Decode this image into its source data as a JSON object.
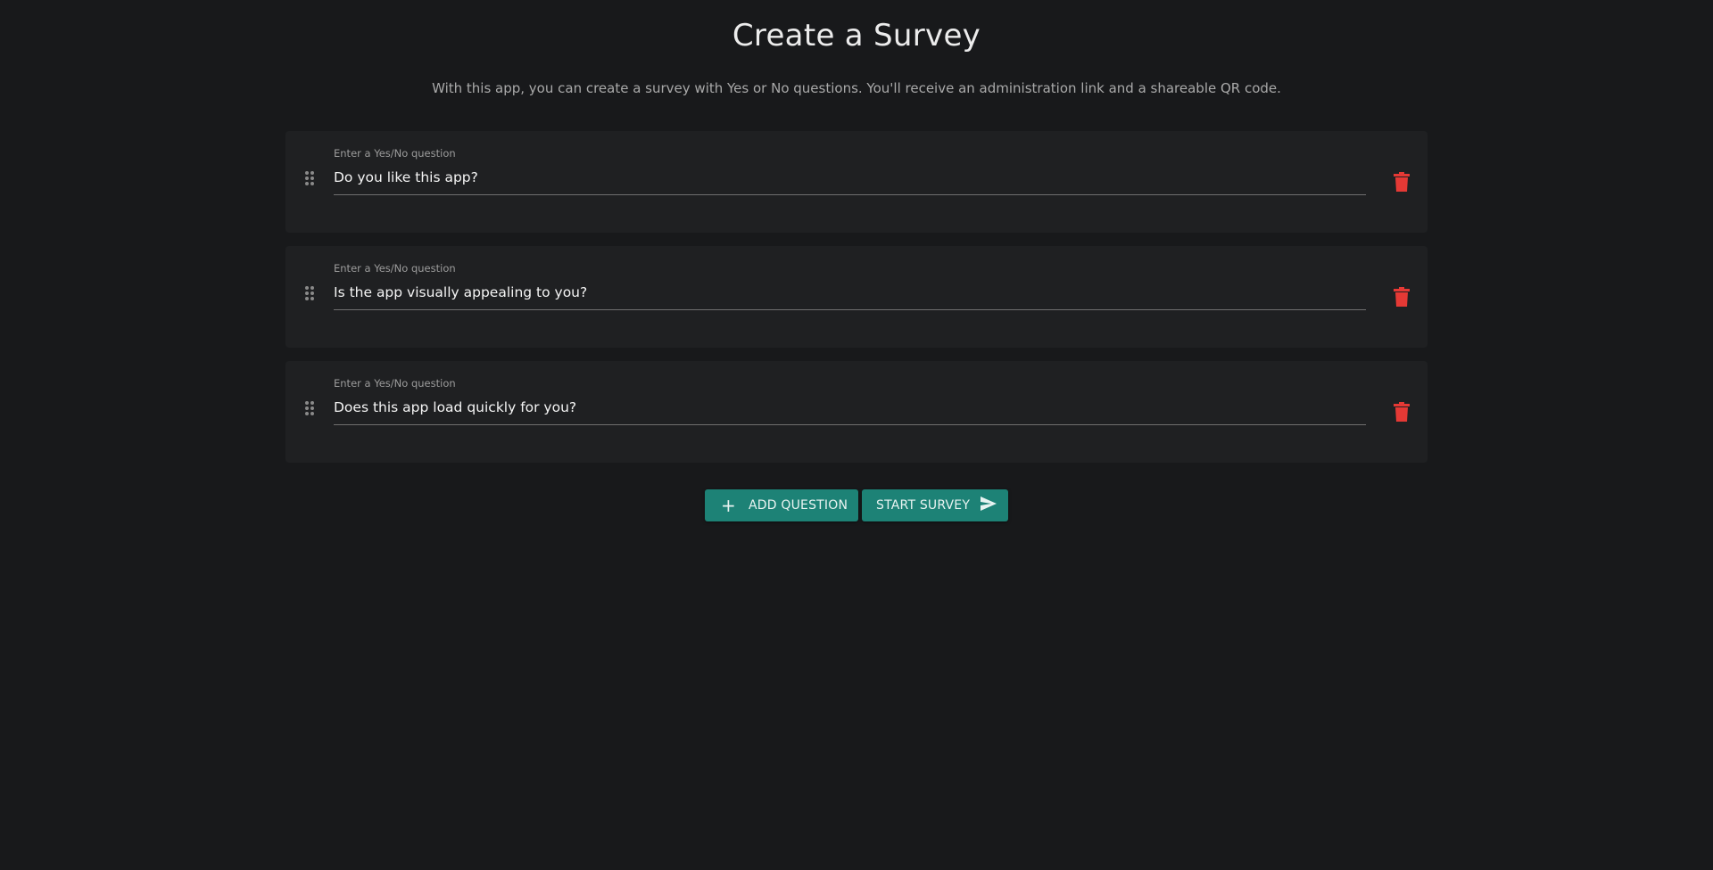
{
  "header": {
    "title": "Create a Survey",
    "subtitle": "With this app, you can create a survey with Yes or No questions. You'll receive an administration link and a shareable QR code."
  },
  "questions": [
    {
      "label": "Enter a Yes/No question",
      "value": "Do you like this app?"
    },
    {
      "label": "Enter a Yes/No question",
      "value": "Is the app visually appealing to you?"
    },
    {
      "label": "Enter a Yes/No question",
      "value": "Does this app load quickly for you?"
    }
  ],
  "actions": {
    "add_label": "ADD QUESTION",
    "add_icon": "plus-icon",
    "start_label": "START SURVEY",
    "start_icon": "send-icon"
  },
  "icons": {
    "drag": "drag-handle-icon",
    "delete": "trash-icon"
  },
  "colors": {
    "background": "#18191b",
    "card": "#1f2022",
    "accent": "#1d8276",
    "delete": "#e53935"
  }
}
